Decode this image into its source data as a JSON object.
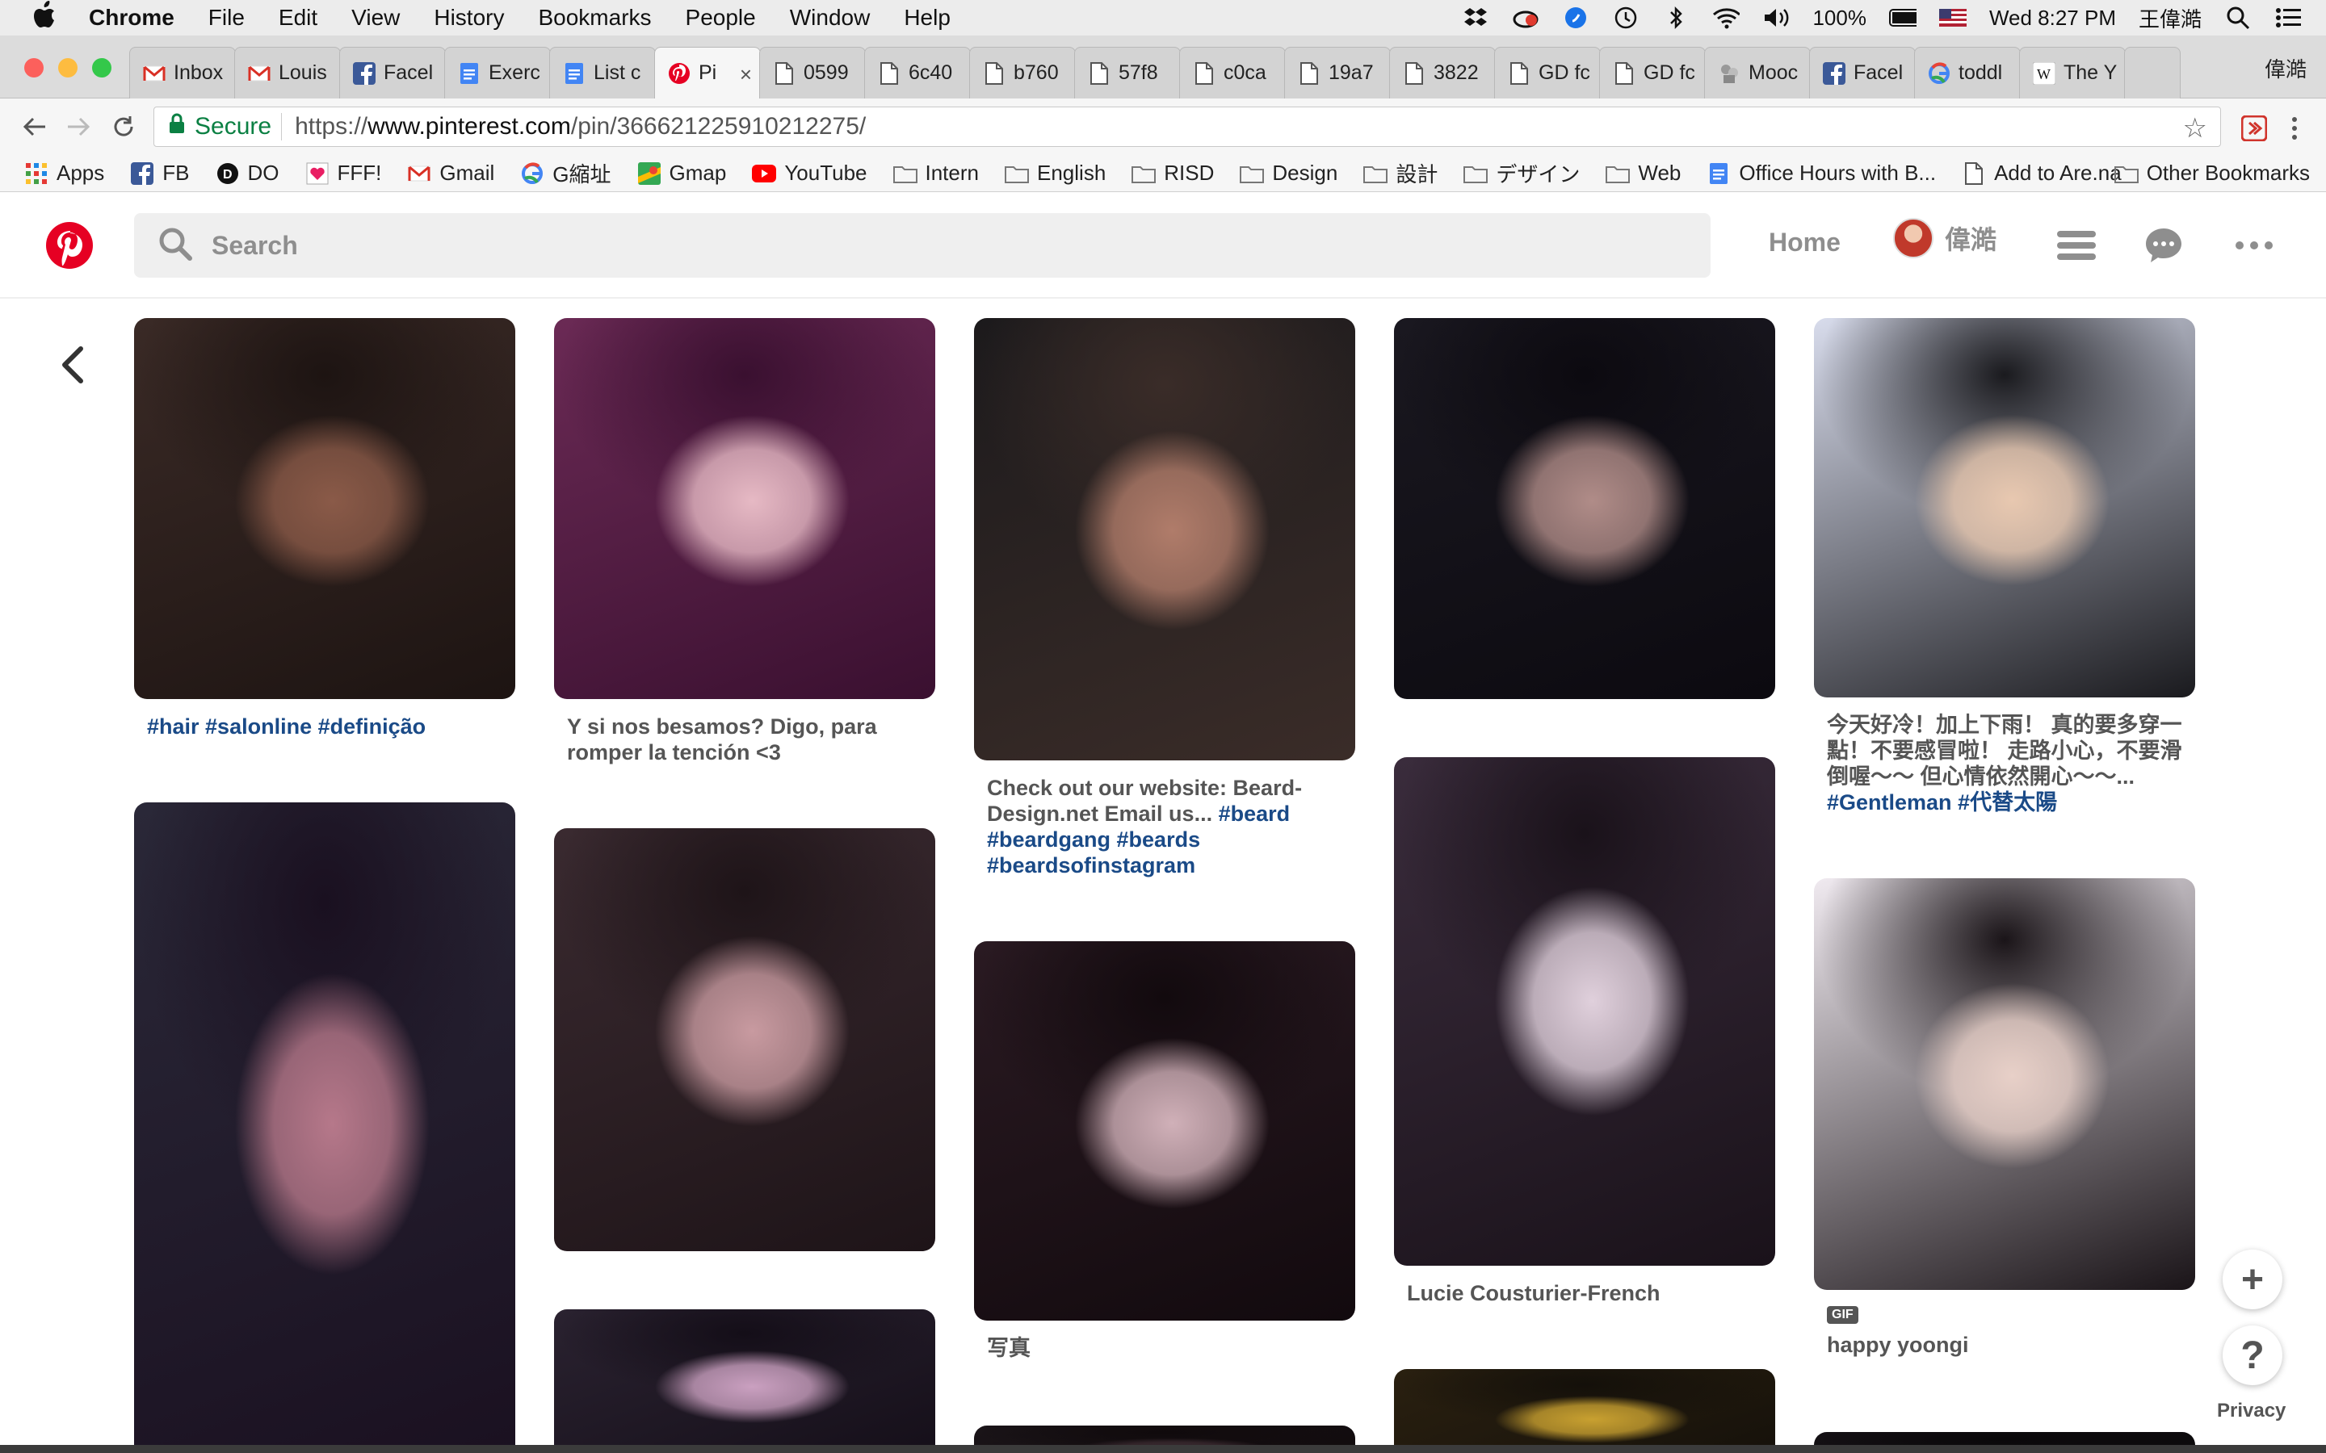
{
  "menubar": {
    "app": "Chrome",
    "items": [
      "File",
      "Edit",
      "View",
      "History",
      "Bookmarks",
      "People",
      "Window",
      "Help"
    ],
    "battery": "100%",
    "clock": "Wed 8:27 PM",
    "user": "王偉澔"
  },
  "tabs": [
    {
      "title": "Inbox",
      "icon": "gmail-icon"
    },
    {
      "title": "Louis",
      "icon": "gmail-icon"
    },
    {
      "title": "Facel",
      "icon": "facebook-icon"
    },
    {
      "title": "Exerc",
      "icon": "doc-icon"
    },
    {
      "title": "List c",
      "icon": "doc-icon"
    },
    {
      "title": "Pi",
      "icon": "pinterest-icon",
      "active": true
    },
    {
      "title": "0599",
      "icon": "page-icon"
    },
    {
      "title": "6c40",
      "icon": "page-icon"
    },
    {
      "title": "b760",
      "icon": "page-icon"
    },
    {
      "title": "57f8",
      "icon": "page-icon"
    },
    {
      "title": "c0ca",
      "icon": "page-icon"
    },
    {
      "title": "19a7",
      "icon": "page-icon"
    },
    {
      "title": "3822",
      "icon": "page-icon"
    },
    {
      "title": "GD fc",
      "icon": "page-icon"
    },
    {
      "title": "GD fc",
      "icon": "page-icon"
    },
    {
      "title": "Mooc",
      "icon": "mooc-icon"
    },
    {
      "title": "Facel",
      "icon": "facebook-icon"
    },
    {
      "title": "toddl",
      "icon": "google-icon"
    },
    {
      "title": "The Y",
      "icon": "wikipedia-icon"
    }
  ],
  "tabstrip_user": "偉澔",
  "address": {
    "secure_label": "Secure",
    "url_scheme": "https://",
    "url_host": "www.pinterest.com",
    "url_path": "/pin/366621225910212275/"
  },
  "bookmarks": [
    {
      "label": "Apps",
      "icon": "apps-grid-icon"
    },
    {
      "label": "FB",
      "icon": "facebook-icon"
    },
    {
      "label": "DO",
      "icon": "do-icon"
    },
    {
      "label": "FFF!",
      "icon": "heart-icon"
    },
    {
      "label": "Gmail",
      "icon": "gmail-icon"
    },
    {
      "label": "G縮址",
      "icon": "google-icon"
    },
    {
      "label": "Gmap",
      "icon": "map-icon"
    },
    {
      "label": "YouTube",
      "icon": "youtube-icon"
    },
    {
      "label": "Intern",
      "icon": "folder-icon"
    },
    {
      "label": "English",
      "icon": "folder-icon"
    },
    {
      "label": "RISD",
      "icon": "folder-icon"
    },
    {
      "label": "Design",
      "icon": "folder-icon"
    },
    {
      "label": "設計",
      "icon": "folder-icon"
    },
    {
      "label": "デザイン",
      "icon": "folder-icon"
    },
    {
      "label": "Web",
      "icon": "folder-icon"
    },
    {
      "label": "Office Hours with B...",
      "icon": "doc-icon"
    },
    {
      "label": "Add to Are.na",
      "icon": "page-icon"
    }
  ],
  "other_bookmarks": "Other Bookmarks",
  "pinterest": {
    "search_placeholder": "Search",
    "home": "Home",
    "username": "偉澔"
  },
  "pins": [
    {
      "col": 0,
      "desc_tags": "#hair #salonline #definição",
      "colors": [
        "#3a2a26",
        "#8a5a48",
        "#1d1412"
      ]
    },
    {
      "col": 0,
      "desc": "",
      "colors": [
        "#2a2838",
        "#b6788a",
        "#1a1020"
      ]
    },
    {
      "col": 1,
      "desc": "Y si nos besamos? Digo, para romper la tención <3",
      "colors": [
        "#6b2a55",
        "#e6b9c4",
        "#3a1030"
      ]
    },
    {
      "col": 1,
      "desc": "",
      "colors": [
        "#3a2a30",
        "#c89aa0",
        "#1e1418"
      ]
    },
    {
      "col": 1,
      "desc": "",
      "colors": [
        "#2a2230",
        "#caa0c0",
        "#140e18"
      ]
    },
    {
      "col": 2,
      "desc": "Check out our website: Beard-Design.net Email us...",
      "desc_tags": "#beard #beardgang #beards #beardsofinstagram",
      "colors": [
        "#1c1a1c",
        "#b07c6a",
        "#3a2c28"
      ]
    },
    {
      "col": 2,
      "desc": "写真",
      "colors": [
        "#2a1a22",
        "#d0b0b8",
        "#120a0e"
      ]
    },
    {
      "col": 2,
      "desc": "",
      "colors": [
        "#1a1418",
        "#3a2a30",
        "#100a0c"
      ]
    },
    {
      "col": 3,
      "desc": "",
      "colors": [
        "#1a1820",
        "#b08c88",
        "#0c0a10"
      ]
    },
    {
      "col": 3,
      "desc": "Lucie Cousturier-French",
      "colors": [
        "#3a2c3c",
        "#e0d0dc",
        "#1a121a"
      ]
    },
    {
      "col": 3,
      "desc": "",
      "colors": [
        "#2a2010",
        "#c8a030",
        "#14100a"
      ]
    },
    {
      "col": 4,
      "desc": "今天好冷！加上下雨！ 真的要多穿一點！不要感冒啦！ 走路小心，不要滑倒喔～～ 但心情依然開心～～...",
      "desc_tags": "#Gentleman #代替太陽",
      "colors": [
        "#d8dcec",
        "#e8c8b0",
        "#1a1a1e"
      ]
    },
    {
      "col": 4,
      "desc": "happy yoongi",
      "gif_badge": "GIF",
      "colors": [
        "#f0eaf0",
        "#e8d0c8",
        "#1a1418"
      ]
    },
    {
      "col": 4,
      "desc": "",
      "colors": [
        "#141014",
        "#2a2024",
        "#0a080a"
      ]
    }
  ],
  "floating": {
    "add": "+",
    "help": "?",
    "privacy": "Privacy"
  }
}
